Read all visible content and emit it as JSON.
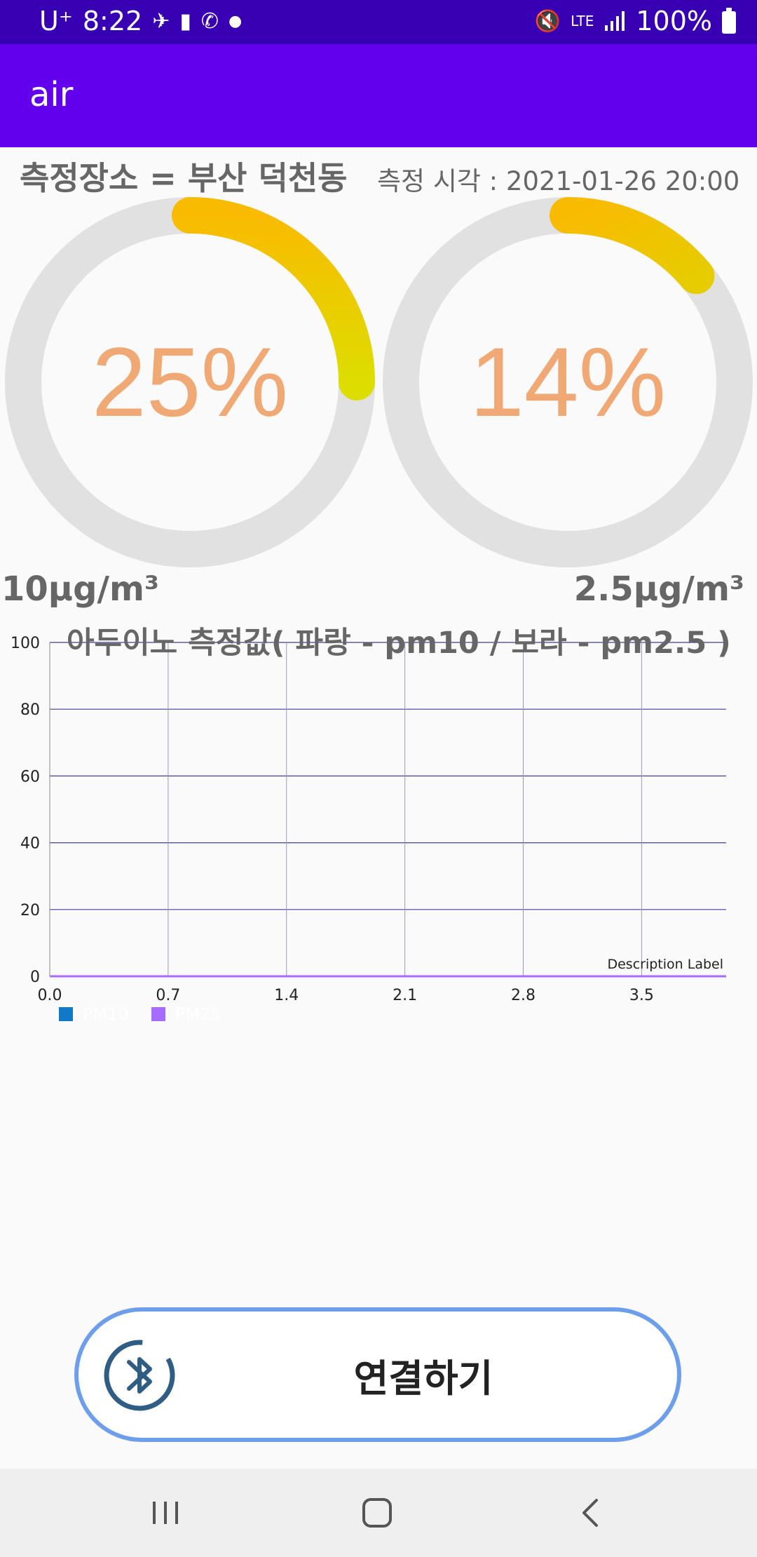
{
  "status_bar": {
    "carrier": "U⁺",
    "time": "8:22",
    "network": "LTE",
    "battery": "100%"
  },
  "app_bar": {
    "title": "air"
  },
  "header": {
    "location": "측정장소 = 부산 덕천동",
    "measure_time": "측정 시각 : 2021-01-26 20:00"
  },
  "gauges": [
    {
      "value": "25%",
      "fraction": 0.25,
      "unit": "10μg/m³"
    },
    {
      "value": "14%",
      "fraction": 0.14,
      "unit": "2.5μg/m³"
    }
  ],
  "colors": {
    "status_bar": "#3700b3",
    "app_bar": "#6200ee",
    "gauge_track": "#e1e1e1",
    "gauge_start": "#f9bb00",
    "gauge_end": "#dddd00",
    "gauge_text": "#f0a874",
    "button_border": "#6d9eeb",
    "pm10": "#1279c6",
    "pm25": "#a66cff"
  },
  "chart_title": "아두이노 측정값( 파랑 - pm10 / 보라 - pm2.5 )",
  "chart_data": {
    "type": "line",
    "title": "아두이노 측정값( 파랑 - pm10 / 보라 - pm2.5 )",
    "xlim": [
      0,
      4.0
    ],
    "ylim": [
      0,
      100
    ],
    "x_ticks": [
      "0.0",
      "0.7",
      "1.4",
      "2.1",
      "2.8",
      "3.5"
    ],
    "y_ticks": [
      "0",
      "20",
      "40",
      "60",
      "80",
      "100"
    ],
    "description": "Description Label",
    "grid": true,
    "series": [
      {
        "name": "PM10",
        "color": "#1279c6",
        "x": [
          0,
          4.0
        ],
        "y": [
          0,
          0
        ]
      },
      {
        "name": "PM25",
        "color": "#a66cff",
        "x": [
          0,
          4.0
        ],
        "y": [
          0,
          0
        ]
      }
    ]
  },
  "legend": [
    "PM10",
    "PM25"
  ],
  "connect_button": {
    "label": "연결하기",
    "icon": "bluetooth-icon"
  },
  "nav": {
    "recent": "recent-apps-icon",
    "home": "home-icon",
    "back": "back-icon"
  }
}
